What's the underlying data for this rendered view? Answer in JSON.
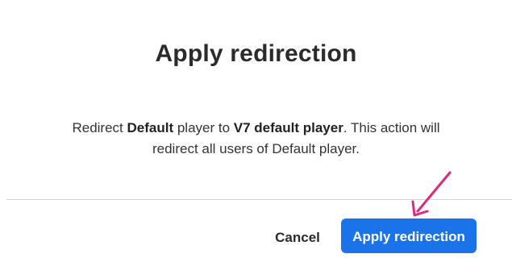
{
  "dialog": {
    "title": "Apply redirection",
    "message": {
      "part1": "Redirect ",
      "source_player": "Default",
      "part2": " player to ",
      "target_player": "V7 default player",
      "part3": ". This action will redirect all users of Default player."
    },
    "cancel_label": "Cancel",
    "apply_label": "Apply redirection"
  },
  "colors": {
    "primary": "#1a73e8",
    "annotation_arrow": "#e0287a",
    "divider": "#d6d6d6"
  },
  "icons": {
    "annotation": "arrow-pointer-icon"
  }
}
